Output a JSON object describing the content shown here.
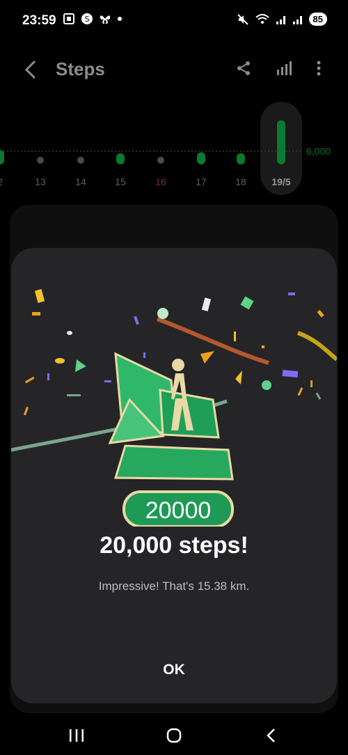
{
  "status_bar": {
    "time": "23:59",
    "battery": "85"
  },
  "header": {
    "title": "Steps"
  },
  "chart": {
    "days": [
      "2",
      "13",
      "14",
      "15",
      "16",
      "17",
      "18",
      "19/5"
    ],
    "highlighted_day": "16",
    "selected_day": "19/5",
    "goal_label": "6,000"
  },
  "chart_data": {
    "type": "bar",
    "categories": [
      "2",
      "13",
      "14",
      "15",
      "16",
      "17",
      "18",
      "19/5"
    ],
    "values": [
      6500,
      0,
      0,
      3000,
      0,
      5500,
      4000,
      20000
    ],
    "goal": 6000
  },
  "dialog": {
    "badge_number": "20000",
    "headline": "20,000 steps!",
    "subtext": "Impressive! That's 15.38 km.",
    "ok_label": "OK"
  },
  "colors": {
    "accent_green": "#0aa33a",
    "badge_green": "#2fb86a",
    "dialog_bg": "#252527"
  }
}
